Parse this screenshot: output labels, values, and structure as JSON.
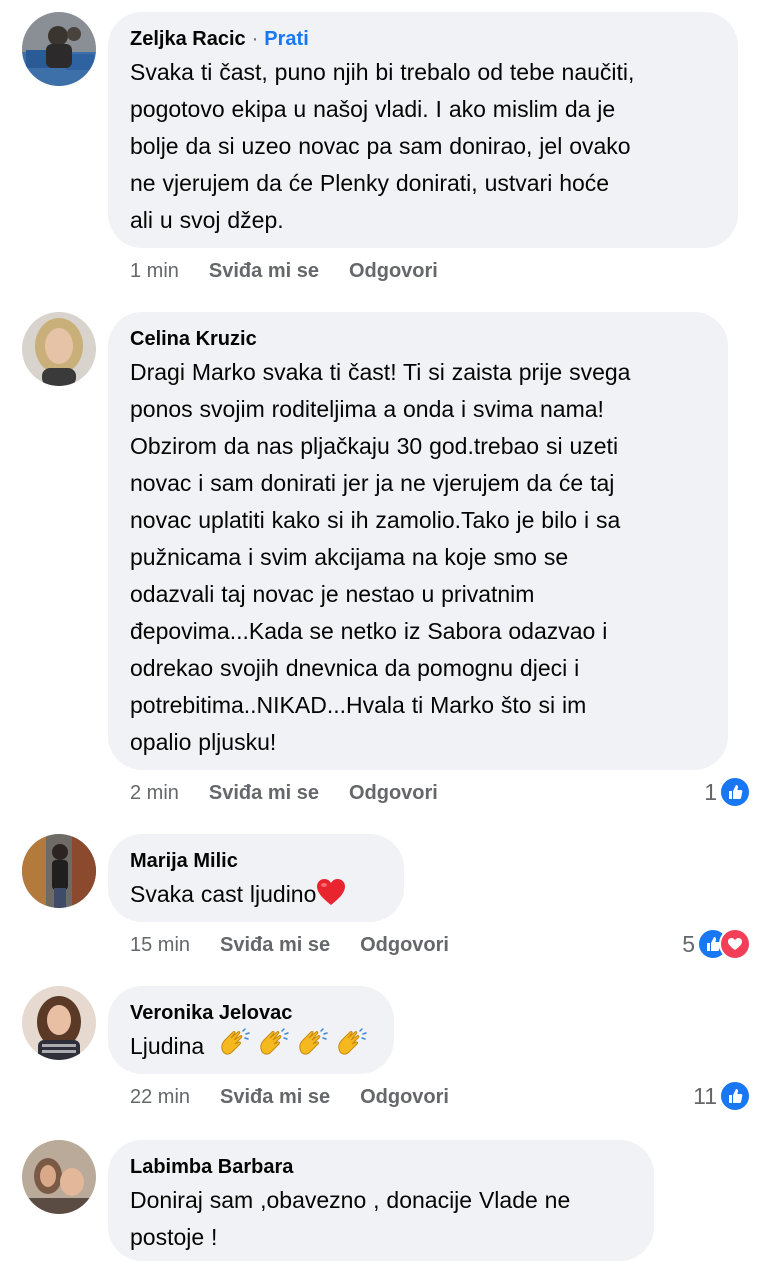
{
  "actions": {
    "like_label": "Sviđa mi se",
    "reply_label": "Odgovori"
  },
  "comments": [
    {
      "author": "Zeljka Racic",
      "separator": "·",
      "follow_label": "Prati",
      "lines": [
        "Svaka ti čast, puno njih bi trebalo od tebe naučiti,",
        "pogotovo ekipa u našoj vladi. I ako mislim da je",
        "bolje da si uzeo novac pa sam donirao, jel ovako",
        "ne vjerujem da će Plenky donirati, ustvari  hoće",
        "ali u svoj džep."
      ],
      "time": "1 min"
    },
    {
      "author": "Celina Kruzic",
      "lines": [
        "Dragi Marko svaka ti čast! Ti si zaista prije svega",
        "ponos svojim roditeljima a onda i svima nama!",
        "Obzirom da nas pljačkaju 30 god.trebao si uzeti",
        "novac i sam donirati jer ja ne vjerujem da će taj",
        "novac uplatiti kako si ih zamolio.Tako je bilo i sa",
        "pužnicama i svim akcijama na koje smo se",
        "odazvali taj novac je nestao u privatnim",
        "đepovima...Kada se netko iz Sabora odazvao i",
        "odrekao svojih dnevnica da pomognu djeci i",
        "potrebitima..NIKAD...Hvala ti Marko što si im",
        "opalio pljusku!"
      ],
      "time": "2 min",
      "reaction_count": "1",
      "reaction_icons": [
        "like-icon"
      ]
    },
    {
      "author": "Marija Milic",
      "text": "Svaka cast ljudino",
      "emoji": "heart-icon",
      "time": "15 min",
      "reaction_count": "5",
      "reaction_icons": [
        "like-icon",
        "love-icon"
      ]
    },
    {
      "author": "Veronika Jelovac",
      "text": "Ljudina",
      "emoji": "clapping-hands-icon",
      "emoji_count": 4,
      "time": "22 min",
      "reaction_count": "11",
      "reaction_icons": [
        "like-icon"
      ]
    },
    {
      "author": "Labimba Barbara",
      "lines": [
        "Doniraj sam ,obavezno , donacije Vlade ne",
        "postoje !"
      ]
    }
  ],
  "colors": {
    "bubble": "#f0f2f5",
    "link": "#1877f2",
    "meta": "#65676b",
    "like": "#1877f2",
    "love": "#f33e58"
  }
}
